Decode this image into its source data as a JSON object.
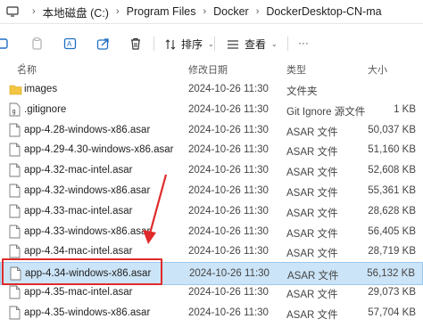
{
  "address_bar": {
    "crumbs": [
      "本地磁盘 (C:)",
      "Program Files",
      "Docker",
      "DockerDesktop-CN-ma"
    ]
  },
  "toolbar": {
    "sort_label": "排序",
    "view_label": "查看",
    "icons": [
      "new-icon",
      "copy-icon",
      "rename-icon",
      "share-icon",
      "delete-icon"
    ]
  },
  "columns": {
    "name": "名称",
    "date": "修改日期",
    "type": "类型",
    "size": "大小"
  },
  "files": [
    {
      "name": "images",
      "date": "2024-10-26 11:30",
      "type": "文件夹",
      "size": "",
      "kind": "folder"
    },
    {
      "name": ".gitignore",
      "date": "2024-10-26 11:30",
      "type": "Git Ignore 源文件",
      "size": "1 KB",
      "kind": "git"
    },
    {
      "name": "app-4.28-windows-x86.asar",
      "date": "2024-10-26 11:30",
      "type": "ASAR 文件",
      "size": "50,037 KB",
      "kind": "file"
    },
    {
      "name": "app-4.29-4.30-windows-x86.asar",
      "date": "2024-10-26 11:30",
      "type": "ASAR 文件",
      "size": "51,160 KB",
      "kind": "file"
    },
    {
      "name": "app-4.32-mac-intel.asar",
      "date": "2024-10-26 11:30",
      "type": "ASAR 文件",
      "size": "52,608 KB",
      "kind": "file"
    },
    {
      "name": "app-4.32-windows-x86.asar",
      "date": "2024-10-26 11:30",
      "type": "ASAR 文件",
      "size": "55,361 KB",
      "kind": "file"
    },
    {
      "name": "app-4.33-mac-intel.asar",
      "date": "2024-10-26 11:30",
      "type": "ASAR 文件",
      "size": "28,628 KB",
      "kind": "file"
    },
    {
      "name": "app-4.33-windows-x86.asar",
      "date": "2024-10-26 11:30",
      "type": "ASAR 文件",
      "size": "56,405 KB",
      "kind": "file"
    },
    {
      "name": "app-4.34-mac-intel.asar",
      "date": "2024-10-26 11:30",
      "type": "ASAR 文件",
      "size": "28,719 KB",
      "kind": "file"
    },
    {
      "name": "app-4.34-windows-x86.asar",
      "date": "2024-10-26 11:30",
      "type": "ASAR 文件",
      "size": "56,132 KB",
      "kind": "file",
      "selected": true
    },
    {
      "name": "app-4.35-mac-intel.asar",
      "date": "2024-10-26 11:30",
      "type": "ASAR 文件",
      "size": "29,073 KB",
      "kind": "file"
    },
    {
      "name": "app-4.35-windows-x86.asar",
      "date": "2024-10-26 11:30",
      "type": "ASAR 文件",
      "size": "57,704 KB",
      "kind": "file"
    }
  ],
  "colors": {
    "selection_bg": "#cce4f7",
    "annotation_red": "#e02a2a",
    "folder_yellow": "#f4c542"
  }
}
